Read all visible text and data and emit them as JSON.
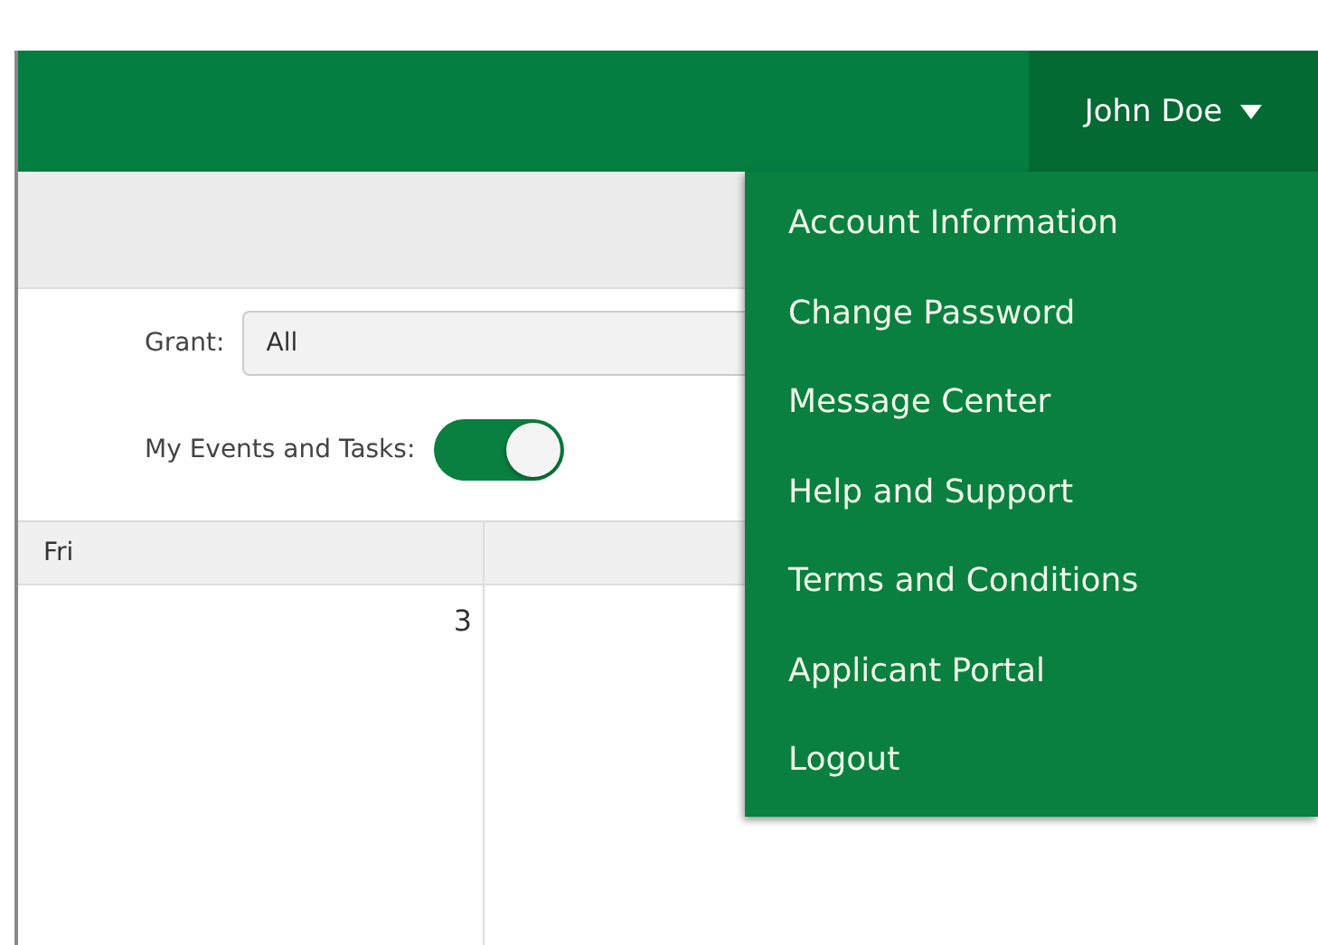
{
  "header": {
    "user_name": "John Doe",
    "menu_open": true
  },
  "user_menu": [
    {
      "label": "Account Information"
    },
    {
      "label": "Change Password"
    },
    {
      "label": "Message Center"
    },
    {
      "label": "Help and Support"
    },
    {
      "label": "Terms and Conditions"
    },
    {
      "label": "Applicant Portal"
    },
    {
      "label": "Logout"
    }
  ],
  "filters": {
    "grant_label": "Grant:",
    "grant_value": "All",
    "events_label": "My Events and Tasks:",
    "events_on": true
  },
  "calendar": {
    "columns": [
      "Fri"
    ],
    "days": [
      "3"
    ]
  }
}
